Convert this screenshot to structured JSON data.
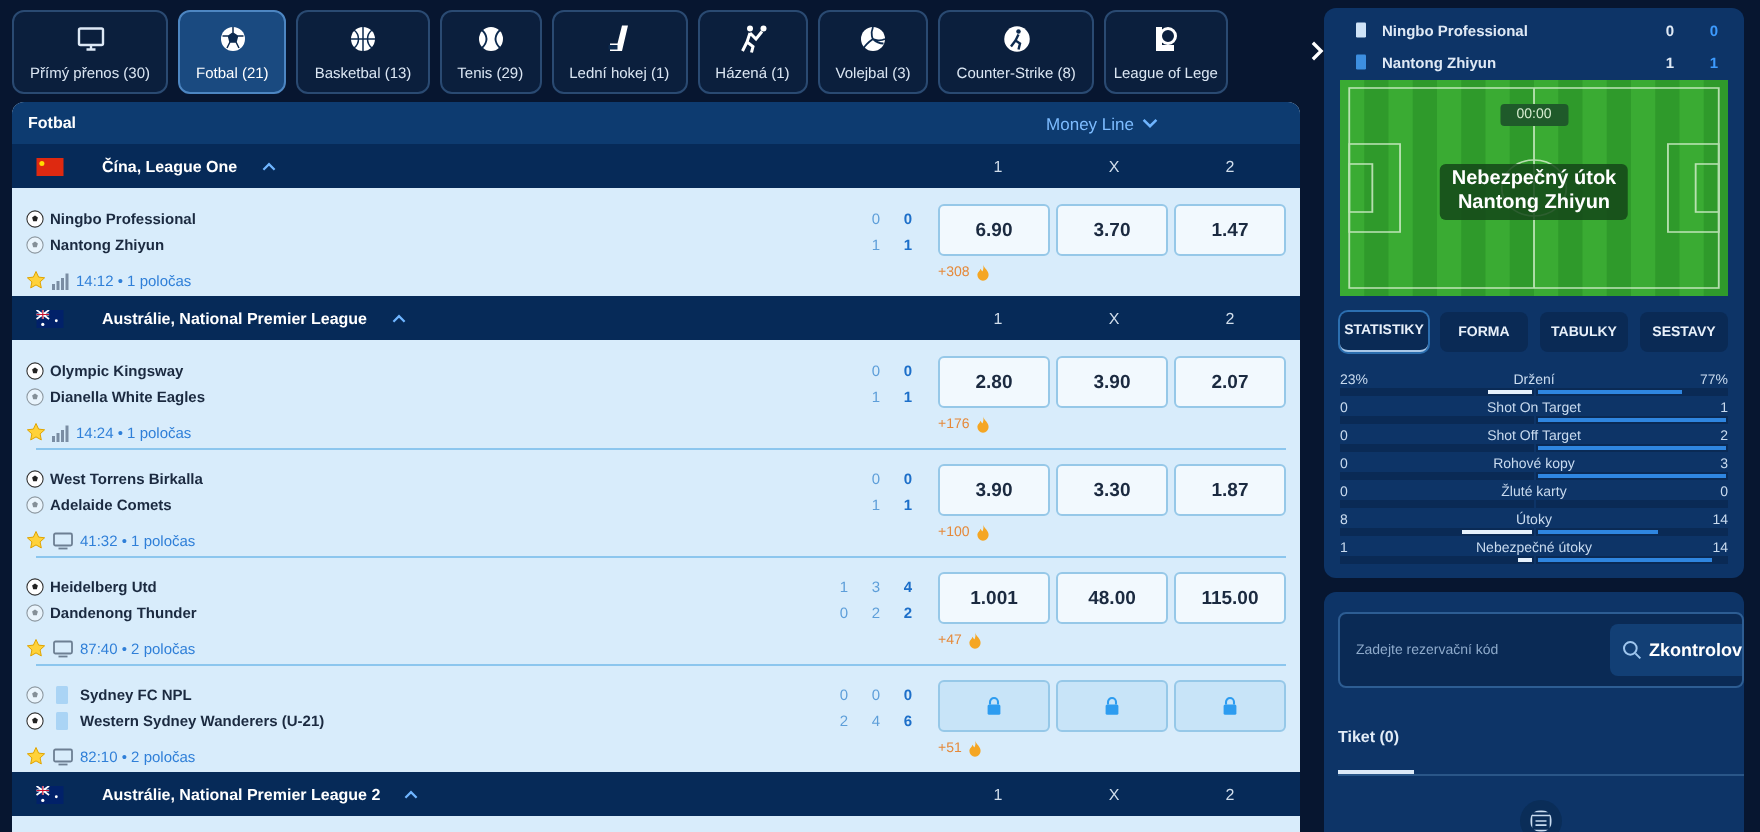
{
  "sport_tabs": [
    {
      "label": "Přímý přenos (30)",
      "selected": false
    },
    {
      "label": "Fotbal (21)",
      "selected": true
    },
    {
      "label": "Basketbal (13)",
      "selected": false
    },
    {
      "label": "Tenis (29)",
      "selected": false
    },
    {
      "label": "Lední hokej (1)",
      "selected": false
    },
    {
      "label": "Házená (1)",
      "selected": false
    },
    {
      "label": "Volejbal (3)",
      "selected": false
    },
    {
      "label": "Counter-Strike (8)",
      "selected": false
    },
    {
      "label": "League of Lege",
      "selected": false
    }
  ],
  "list": {
    "title": "Fotbal",
    "market": "Money Line",
    "leagues": [
      {
        "name": "Čína, League One",
        "kind": "cn",
        "cols": [
          "1",
          "X",
          "2"
        ],
        "matches": [
          {
            "teams": [
              {
                "name": "Ningbo Professional",
                "active": true,
                "shirt": false,
                "scores": [
                  "0",
                  "0"
                ]
              },
              {
                "name": "Nantong Zhiyun",
                "active": false,
                "shirt": false,
                "scores": [
                  "1",
                  "1"
                ]
              }
            ],
            "odds": [
              {
                "value": "6.90",
                "locked": false
              },
              {
                "value": "3.70",
                "locked": false
              },
              {
                "value": "1.47",
                "locked": false
              }
            ],
            "kind": "stats",
            "time": "14:12 • 1 poločas",
            "more": "+308"
          }
        ]
      },
      {
        "name": "Austrálie, National Premier League",
        "kind": "au",
        "cols": [
          "1",
          "X",
          "2"
        ],
        "matches": [
          {
            "teams": [
              {
                "name": "Olympic Kingsway",
                "active": true,
                "shirt": false,
                "scores": [
                  "0",
                  "0"
                ]
              },
              {
                "name": "Dianella White Eagles",
                "active": false,
                "shirt": false,
                "scores": [
                  "1",
                  "1"
                ]
              }
            ],
            "odds": [
              {
                "value": "2.80",
                "locked": false
              },
              {
                "value": "3.90",
                "locked": false
              },
              {
                "value": "2.07",
                "locked": false
              }
            ],
            "kind": "stats",
            "time": "14:24 • 1 poločas",
            "more": "+176"
          },
          {
            "teams": [
              {
                "name": "West Torrens Birkalla",
                "active": true,
                "shirt": false,
                "scores": [
                  "0",
                  "0"
                ]
              },
              {
                "name": "Adelaide Comets",
                "active": false,
                "shirt": false,
                "scores": [
                  "1",
                  "1"
                ]
              }
            ],
            "odds": [
              {
                "value": "3.90",
                "locked": false
              },
              {
                "value": "3.30",
                "locked": false
              },
              {
                "value": "1.87",
                "locked": false
              }
            ],
            "kind": "tv",
            "time": "41:32 • 1 poločas",
            "more": "+100"
          },
          {
            "teams": [
              {
                "name": "Heidelberg Utd",
                "active": true,
                "shirt": false,
                "scores": [
                  "1",
                  "3",
                  "4"
                ]
              },
              {
                "name": "Dandenong Thunder",
                "active": false,
                "shirt": false,
                "scores": [
                  "0",
                  "2",
                  "2"
                ]
              }
            ],
            "odds": [
              {
                "value": "1.001",
                "locked": false
              },
              {
                "value": "48.00",
                "locked": false
              },
              {
                "value": "115.00",
                "locked": false
              }
            ],
            "kind": "tv",
            "time": "87:40 • 2 poločas",
            "more": "+47"
          },
          {
            "teams": [
              {
                "name": "Sydney FC NPL",
                "active": false,
                "shirt": true,
                "scores": [
                  "0",
                  "0",
                  "0"
                ]
              },
              {
                "name": "Western Sydney Wanderers (U-21)",
                "active": true,
                "shirt": true,
                "scores": [
                  "2",
                  "4",
                  "6"
                ]
              }
            ],
            "odds": [
              {
                "locked": true
              },
              {
                "locked": true
              },
              {
                "locked": true
              }
            ],
            "kind": "tv",
            "time": "82:10 • 2 poločas",
            "more": "+51"
          }
        ]
      },
      {
        "name": "Austrálie, National Premier League 2",
        "kind": "au",
        "cols": [
          "1",
          "X",
          "2"
        ]
      }
    ]
  },
  "live": {
    "teams": [
      {
        "name": "Ningbo Professional",
        "scores": [
          "0",
          "0"
        ]
      },
      {
        "name": "Nantong Zhiyun",
        "scores": [
          "1",
          "1"
        ]
      }
    ],
    "clock": "00:00",
    "event": "Nebezpečný útok\nNantong Zhiyun",
    "tabs": [
      {
        "label": "STATISTIKY",
        "selected": true
      },
      {
        "label": "FORMA",
        "selected": false
      },
      {
        "label": "TABULKY",
        "selected": false
      },
      {
        "label": "SESTAVY",
        "selected": false
      }
    ],
    "stats": [
      {
        "label": "Držení",
        "home": {
          "value": "23%",
          "level": 0.23
        },
        "away": {
          "value": "77%",
          "level": 0.77
        }
      },
      {
        "label": "Shot On Target",
        "home": {
          "value": "0"
        },
        "away": {
          "value": "1",
          "level": 1
        }
      },
      {
        "label": "Shot Off Target",
        "home": {
          "value": "0"
        },
        "away": {
          "value": "2",
          "level": 1
        }
      },
      {
        "label": "Rohové kopy",
        "home": {
          "value": "0"
        },
        "away": {
          "value": "3",
          "level": 1
        }
      },
      {
        "label": "Žluté karty",
        "home": {
          "value": "0"
        },
        "away": {
          "value": "0"
        }
      },
      {
        "label": "Útoky",
        "home": {
          "value": "8",
          "level": 0.36
        },
        "away": {
          "value": "14",
          "level": 0.64
        }
      },
      {
        "label": "Nebezpečné útoky",
        "home": {
          "value": "1",
          "level": 0.07
        },
        "away": {
          "value": "14",
          "level": 0.93
        }
      }
    ]
  },
  "ticket": {
    "placeholder": "Zadejte rezervační kód",
    "check": "Zkontrolov",
    "tabs": [
      {
        "label": "Tiket (0)",
        "selected": true
      }
    ]
  }
}
